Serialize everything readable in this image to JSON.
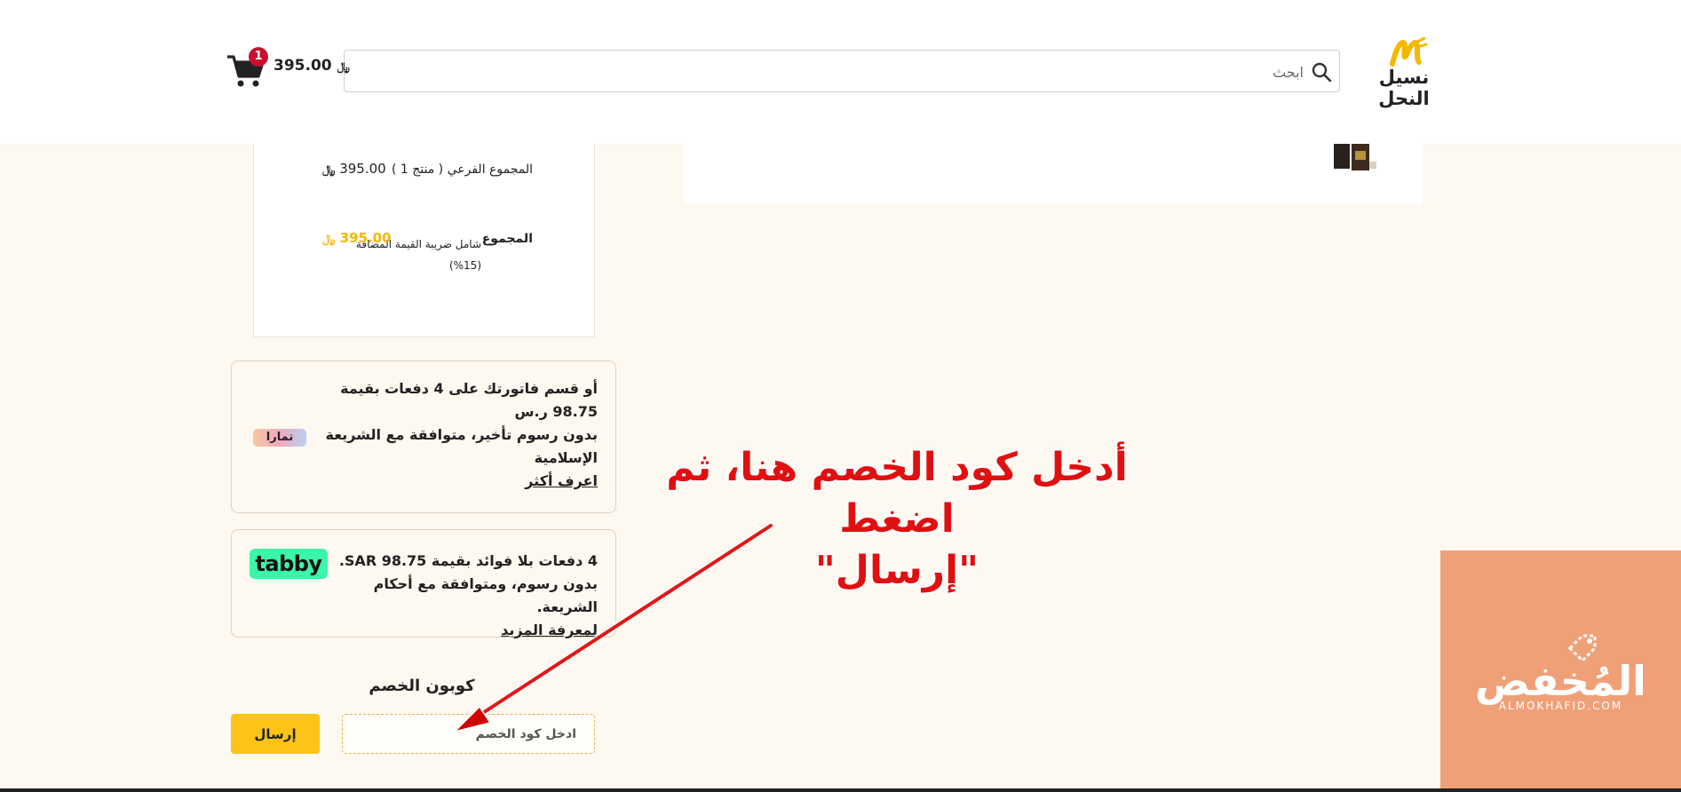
{
  "header": {
    "logo_text": "نسيل النحل",
    "search_placeholder": "ابحث",
    "cart_total": "395.00",
    "cart_count": "1"
  },
  "summary": {
    "subtotal_label": "المجموع الفرعي ( منتج 1 )",
    "subtotal_value": "395.00",
    "total_label": "المجموع",
    "tax_note": "شامل ضريبة القيمة المضافة (15%)",
    "total_value": "395.00"
  },
  "tamara": {
    "line1": "أو قسم فاتورتك على 4 دفعات بقيمة",
    "line2": "98.75 ر.س",
    "line3": "بدون رسوم تأخير، متوافقة مع الشريعة",
    "line4": "الإسلامية",
    "link": "اعرف أكثر",
    "logo": "تمارا"
  },
  "tabby": {
    "line1": "4 دفعات بلا فوائد بقيمة SAR 98.75.",
    "line2": "بدون رسوم، ومتوافقة مع أحكام الشريعة.",
    "link": "لمعرفة المزيد",
    "logo": "tabby"
  },
  "coupon": {
    "title": "كوبون الخصم",
    "placeholder": "ادخل كود الخصم",
    "submit_label": "إرسال"
  },
  "annotation": {
    "line1": "أدخل كود الخصم هنا، ثم اضغط",
    "line2": "\"إرسال\""
  },
  "watermark": {
    "text": "المُخفض",
    "sub": "ALMOKHAFID.COM"
  },
  "colors": {
    "accent_yellow": "#fcc419",
    "badge_red": "#c8102e",
    "annotation_red": "#e01010",
    "tabby_green": "#3bf5a8",
    "watermark_orange": "#f0a077"
  }
}
